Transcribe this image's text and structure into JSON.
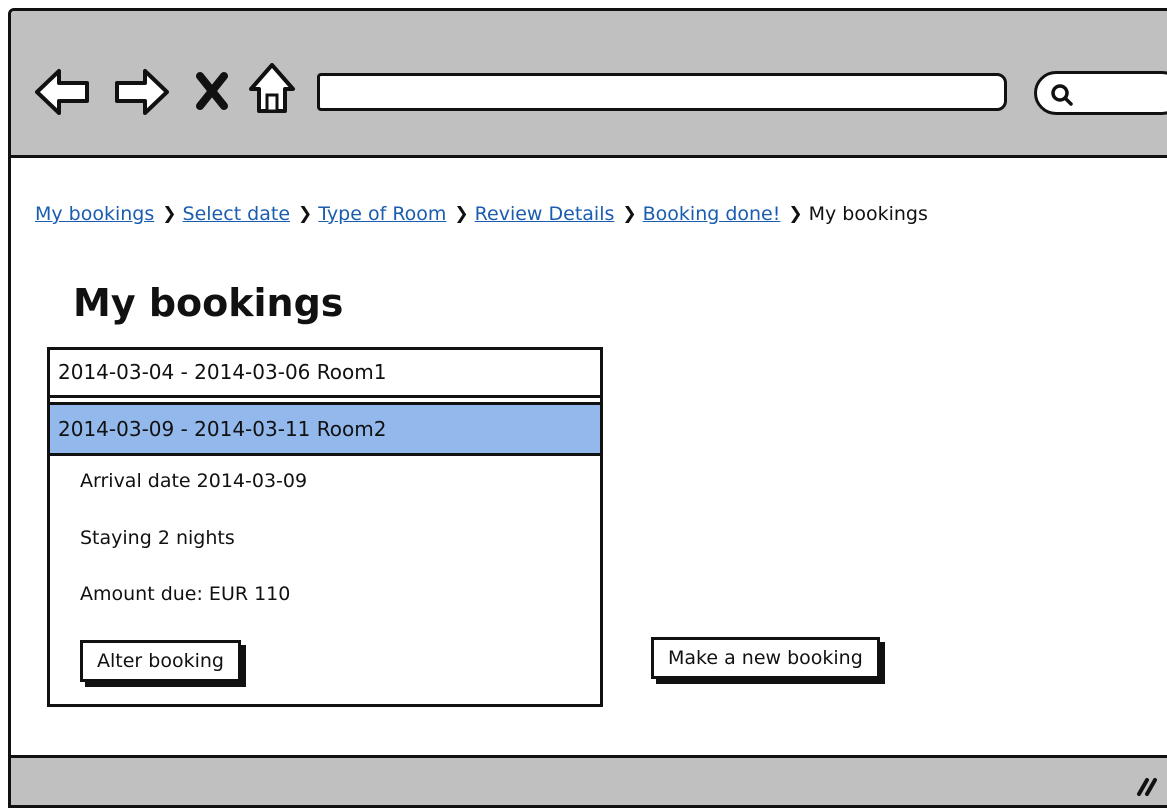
{
  "browser": {
    "address_value": "",
    "icons": [
      "back-arrow-icon",
      "forward-arrow-icon",
      "stop-x-icon",
      "home-icon",
      "search-icon",
      "resize-grip-icon"
    ]
  },
  "breadcrumb": {
    "links": [
      "My bookings",
      "Select  date",
      "Type of Room",
      "Review Details",
      "Booking done!"
    ],
    "current": "My bookings"
  },
  "page": {
    "title": "My bookings"
  },
  "bookings": [
    {
      "label": "2014-03-04 - 2014-03-06 Room1",
      "selected": false
    },
    {
      "label": "2014-03-09 - 2014-03-11 Room2",
      "selected": true
    }
  ],
  "details": {
    "arrival": "Arrival date 2014-03-09",
    "nights": "Staying 2 nights",
    "amount": "Amount due: EUR 110"
  },
  "buttons": {
    "alter": "Alter booking",
    "new_booking": "Make a new booking"
  },
  "colors": {
    "selected_row": "#93b8ec",
    "chrome": "#c0c0c0",
    "link": "#1a5db0"
  }
}
